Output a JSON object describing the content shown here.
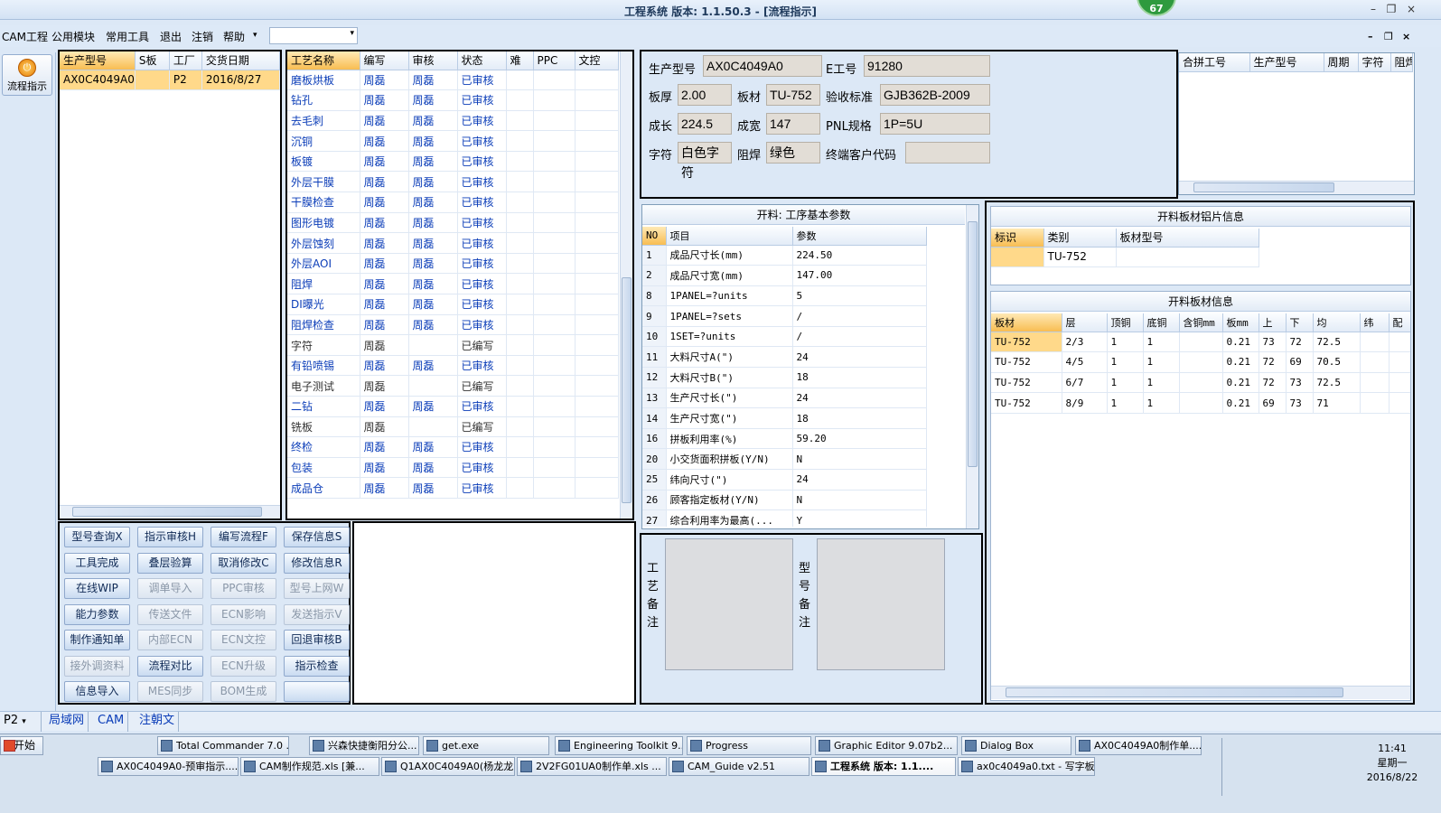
{
  "titlebar": {
    "title": "工程系统  版本: 1.1.50.3 - [流程指示]",
    "badge": "67",
    "min": "–",
    "restore": "❐",
    "close": "×"
  },
  "menu": {
    "items": [
      "CAM工程",
      "公用模块",
      "常用工具",
      "退出",
      "注销",
      "帮助"
    ],
    "help_arrow": "▾",
    "combo_value": "",
    "combo_arrow": "▾",
    "min": "–",
    "restore": "❐",
    "close": "×"
  },
  "leftbar": {
    "flow_button": "流程指示",
    "flow_icon": "power-icon"
  },
  "orders": {
    "headers": [
      "生产型号",
      "S板",
      "工厂",
      "交货日期"
    ],
    "rows": [
      [
        "AX0C4049A0",
        "",
        "P2",
        "2016/8/27"
      ]
    ]
  },
  "processes": {
    "headers": [
      "工艺名称",
      "编写",
      "审核",
      "状态",
      "难",
      "PPC",
      "文控"
    ],
    "rows": [
      [
        "磨板烘板",
        "周磊",
        "周磊",
        "已审核"
      ],
      [
        "钻孔",
        "周磊",
        "周磊",
        "已审核"
      ],
      [
        "去毛刺",
        "周磊",
        "周磊",
        "已审核"
      ],
      [
        "沉铜",
        "周磊",
        "周磊",
        "已审核"
      ],
      [
        "板镀",
        "周磊",
        "周磊",
        "已审核"
      ],
      [
        "外层干膜",
        "周磊",
        "周磊",
        "已审核"
      ],
      [
        "干膜检查",
        "周磊",
        "周磊",
        "已审核"
      ],
      [
        "图形电镀",
        "周磊",
        "周磊",
        "已审核"
      ],
      [
        "外层蚀刻",
        "周磊",
        "周磊",
        "已审核"
      ],
      [
        "外层AOI",
        "周磊",
        "周磊",
        "已审核"
      ],
      [
        "阻焊",
        "周磊",
        "周磊",
        "已审核"
      ],
      [
        "DI曝光",
        "周磊",
        "周磊",
        "已审核"
      ],
      [
        "阻焊检查",
        "周磊",
        "周磊",
        "已审核"
      ],
      [
        "字符",
        "周磊",
        "",
        "已编写"
      ],
      [
        "有铅喷锡",
        "周磊",
        "周磊",
        "已审核"
      ],
      [
        "电子测试",
        "周磊",
        "",
        "已编写"
      ],
      [
        "二钻",
        "周磊",
        "周磊",
        "已审核"
      ],
      [
        "铣板",
        "周磊",
        "",
        "已编写"
      ],
      [
        "终检",
        "周磊",
        "周磊",
        "已审核"
      ],
      [
        "包装",
        "周磊",
        "周磊",
        "已审核"
      ],
      [
        "成品仓",
        "周磊",
        "周磊",
        "已审核"
      ]
    ]
  },
  "buttons": [
    [
      "型号查询X",
      "指示审核H",
      "编写流程F",
      "保存信息S"
    ],
    [
      "工具完成",
      "叠层验算",
      "取消修改C",
      "修改信息R"
    ],
    [
      "在线WIP",
      "调单导入",
      "PPC审核",
      "型号上网W"
    ],
    [
      "能力参数",
      "传送文件",
      "ECN影响",
      "发送指示V"
    ],
    [
      "制作通知单",
      "内部ECN",
      "ECN文控",
      "回退审核B"
    ],
    [
      "接外调资料",
      "流程对比",
      "ECN升级",
      "指示检查"
    ],
    [
      "信息导入",
      "MES同步",
      "BOM生成",
      ""
    ]
  ],
  "buttons_disabled": [
    [
      false,
      false,
      false,
      false
    ],
    [
      false,
      false,
      false,
      false
    ],
    [
      false,
      true,
      true,
      true
    ],
    [
      false,
      true,
      true,
      true
    ],
    [
      false,
      true,
      true,
      false
    ],
    [
      true,
      false,
      true,
      false
    ],
    [
      false,
      true,
      true,
      false
    ]
  ],
  "info": {
    "model_label": "生产型号",
    "model": "AX0C4049A0",
    "e_label": "E工号",
    "e": "91280",
    "thick_label": "板厚",
    "thick": "2.00",
    "mat_label": "板材",
    "mat": "TU-752",
    "std_label": "验收标准",
    "std": "GJB362B-2009",
    "len_label": "成长",
    "len": "224.5",
    "wid_label": "成宽",
    "wid": "147",
    "pnl_label": "PNL规格",
    "pnl": "1P=5U",
    "char_label": "字符",
    "char": "白色字符",
    "mask_label": "阻焊",
    "mask": "绿色",
    "cust_label": "终端客户代码",
    "cust": ""
  },
  "merge": {
    "headers": [
      "合拼工号",
      "生产型号",
      "周期",
      "字符",
      "阻焊"
    ]
  },
  "params": {
    "caption": "开料: 工序基本参数",
    "headers": [
      "NO",
      "项目",
      "参数"
    ],
    "rows": [
      [
        "1",
        "成品尺寸长(mm)",
        "224.50"
      ],
      [
        "2",
        "成品尺寸宽(mm)",
        "147.00"
      ],
      [
        "8",
        "1PANEL=?units",
        "5"
      ],
      [
        "9",
        "1PANEL=?sets",
        "/"
      ],
      [
        "10",
        "1SET=?units",
        "/"
      ],
      [
        "11",
        "大料尺寸A(\")",
        "24"
      ],
      [
        "12",
        "大料尺寸B(\")",
        "18"
      ],
      [
        "13",
        "生产尺寸长(\")",
        "24"
      ],
      [
        "14",
        "生产尺寸宽(\")",
        "18"
      ],
      [
        "16",
        "拼板利用率(%)",
        "59.20"
      ],
      [
        "20",
        "小交货面积拼板(Y/N)",
        "N"
      ],
      [
        "25",
        "纬向尺寸(\")",
        "24"
      ],
      [
        "26",
        "顾客指定板材(Y/N)",
        "N"
      ],
      [
        "27",
        "综合利用率为最高(...",
        "Y"
      ]
    ]
  },
  "foil": {
    "caption": "开料板材铝片信息",
    "headers": [
      "标识",
      "类别",
      "板材型号"
    ],
    "rows": [
      [
        "",
        "TU-752",
        ""
      ]
    ]
  },
  "board": {
    "caption": "开料板材信息",
    "headers": [
      "板材",
      "层",
      "顶铜",
      "底铜",
      "含铜mm",
      "板mm",
      "上",
      "下",
      "均",
      "纬",
      "配"
    ],
    "rows": [
      [
        "TU-752",
        "2/3",
        "1",
        "1",
        "",
        "0.21",
        "73",
        "72",
        "72.5",
        ""
      ],
      [
        "TU-752",
        "4/5",
        "1",
        "1",
        "",
        "0.21",
        "72",
        "69",
        "70.5",
        ""
      ],
      [
        "TU-752",
        "6/7",
        "1",
        "1",
        "",
        "0.21",
        "72",
        "73",
        "72.5",
        ""
      ],
      [
        "TU-752",
        "8/9",
        "1",
        "1",
        "",
        "0.21",
        "69",
        "73",
        "71",
        ""
      ]
    ]
  },
  "memo": {
    "process_label": "工艺备注",
    "model_label": "型号备注"
  },
  "status": {
    "plant": "P2",
    "plant_arrow": "▾",
    "tabs": [
      "局域网",
      "CAM",
      "注朝文"
    ]
  },
  "taskbar": {
    "start": "开始",
    "row1": [
      "Total Commander 7.0 ...",
      "兴森快捷衡阳分公...",
      "get.exe",
      "Engineering Toolkit 9....",
      "Progress",
      "Graphic Editor 9.07b2...",
      "Dialog Box",
      "AX0C4049A0制作单...."
    ],
    "row2": [
      "AX0C4049A0-预审指示....",
      "CAM制作规范.xls [兼...",
      "Q1AX0C4049A0(杨龙龙...",
      "2V2FG01UA0制作单.xls ...",
      "CAM_Guide v2.51",
      "工程系统  版本: 1.1....",
      "ax0c4049a0.txt - 写字板"
    ],
    "time": "11:41",
    "weekday": "星期一",
    "date": "2016/8/22"
  }
}
